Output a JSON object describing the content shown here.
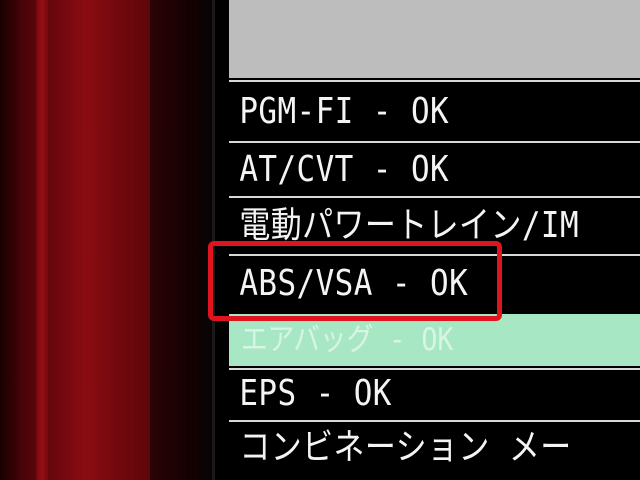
{
  "device": {
    "frame_color": "#8a0c12"
  },
  "screen": {
    "header_bar_color": "#bdbdbd",
    "rows": [
      {
        "label": "PGM-FI - OK"
      },
      {
        "label": "AT/CVT - OK"
      },
      {
        "label": "電動パワートレイン/IM"
      },
      {
        "label": "ABS/VSA - OK"
      },
      {
        "label": "エアバッグ - OK",
        "selected": true
      },
      {
        "label": "EPS - OK"
      },
      {
        "label": "コンビネーション メー"
      }
    ],
    "selected_row_color": "#a8e7c4"
  },
  "annotation": {
    "color": "#e0141e",
    "target": "ABS/VSA - OK"
  }
}
